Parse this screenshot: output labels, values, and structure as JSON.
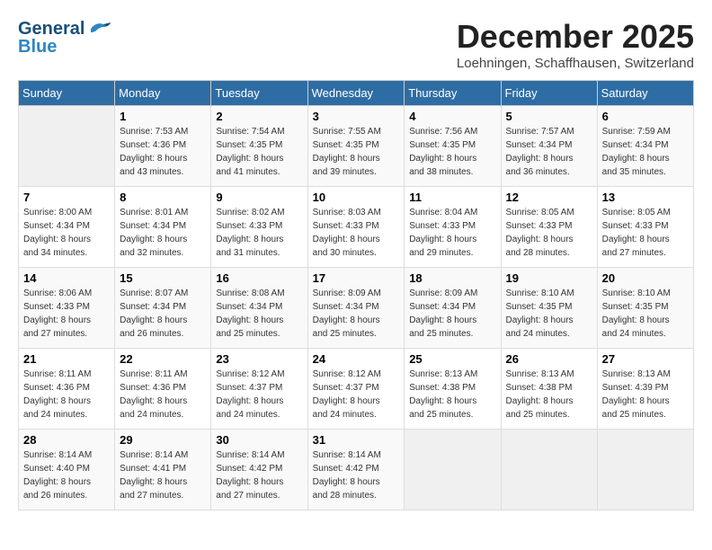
{
  "logo": {
    "line1": "General",
    "line2": "Blue"
  },
  "title": "December 2025",
  "location": "Loehningen, Schaffhausen, Switzerland",
  "weekdays": [
    "Sunday",
    "Monday",
    "Tuesday",
    "Wednesday",
    "Thursday",
    "Friday",
    "Saturday"
  ],
  "weeks": [
    [
      {
        "day": "",
        "info": ""
      },
      {
        "day": "1",
        "info": "Sunrise: 7:53 AM\nSunset: 4:36 PM\nDaylight: 8 hours\nand 43 minutes."
      },
      {
        "day": "2",
        "info": "Sunrise: 7:54 AM\nSunset: 4:35 PM\nDaylight: 8 hours\nand 41 minutes."
      },
      {
        "day": "3",
        "info": "Sunrise: 7:55 AM\nSunset: 4:35 PM\nDaylight: 8 hours\nand 39 minutes."
      },
      {
        "day": "4",
        "info": "Sunrise: 7:56 AM\nSunset: 4:35 PM\nDaylight: 8 hours\nand 38 minutes."
      },
      {
        "day": "5",
        "info": "Sunrise: 7:57 AM\nSunset: 4:34 PM\nDaylight: 8 hours\nand 36 minutes."
      },
      {
        "day": "6",
        "info": "Sunrise: 7:59 AM\nSunset: 4:34 PM\nDaylight: 8 hours\nand 35 minutes."
      }
    ],
    [
      {
        "day": "7",
        "info": "Sunrise: 8:00 AM\nSunset: 4:34 PM\nDaylight: 8 hours\nand 34 minutes."
      },
      {
        "day": "8",
        "info": "Sunrise: 8:01 AM\nSunset: 4:34 PM\nDaylight: 8 hours\nand 32 minutes."
      },
      {
        "day": "9",
        "info": "Sunrise: 8:02 AM\nSunset: 4:33 PM\nDaylight: 8 hours\nand 31 minutes."
      },
      {
        "day": "10",
        "info": "Sunrise: 8:03 AM\nSunset: 4:33 PM\nDaylight: 8 hours\nand 30 minutes."
      },
      {
        "day": "11",
        "info": "Sunrise: 8:04 AM\nSunset: 4:33 PM\nDaylight: 8 hours\nand 29 minutes."
      },
      {
        "day": "12",
        "info": "Sunrise: 8:05 AM\nSunset: 4:33 PM\nDaylight: 8 hours\nand 28 minutes."
      },
      {
        "day": "13",
        "info": "Sunrise: 8:05 AM\nSunset: 4:33 PM\nDaylight: 8 hours\nand 27 minutes."
      }
    ],
    [
      {
        "day": "14",
        "info": "Sunrise: 8:06 AM\nSunset: 4:33 PM\nDaylight: 8 hours\nand 27 minutes."
      },
      {
        "day": "15",
        "info": "Sunrise: 8:07 AM\nSunset: 4:34 PM\nDaylight: 8 hours\nand 26 minutes."
      },
      {
        "day": "16",
        "info": "Sunrise: 8:08 AM\nSunset: 4:34 PM\nDaylight: 8 hours\nand 25 minutes."
      },
      {
        "day": "17",
        "info": "Sunrise: 8:09 AM\nSunset: 4:34 PM\nDaylight: 8 hours\nand 25 minutes."
      },
      {
        "day": "18",
        "info": "Sunrise: 8:09 AM\nSunset: 4:34 PM\nDaylight: 8 hours\nand 25 minutes."
      },
      {
        "day": "19",
        "info": "Sunrise: 8:10 AM\nSunset: 4:35 PM\nDaylight: 8 hours\nand 24 minutes."
      },
      {
        "day": "20",
        "info": "Sunrise: 8:10 AM\nSunset: 4:35 PM\nDaylight: 8 hours\nand 24 minutes."
      }
    ],
    [
      {
        "day": "21",
        "info": "Sunrise: 8:11 AM\nSunset: 4:36 PM\nDaylight: 8 hours\nand 24 minutes."
      },
      {
        "day": "22",
        "info": "Sunrise: 8:11 AM\nSunset: 4:36 PM\nDaylight: 8 hours\nand 24 minutes."
      },
      {
        "day": "23",
        "info": "Sunrise: 8:12 AM\nSunset: 4:37 PM\nDaylight: 8 hours\nand 24 minutes."
      },
      {
        "day": "24",
        "info": "Sunrise: 8:12 AM\nSunset: 4:37 PM\nDaylight: 8 hours\nand 24 minutes."
      },
      {
        "day": "25",
        "info": "Sunrise: 8:13 AM\nSunset: 4:38 PM\nDaylight: 8 hours\nand 25 minutes."
      },
      {
        "day": "26",
        "info": "Sunrise: 8:13 AM\nSunset: 4:38 PM\nDaylight: 8 hours\nand 25 minutes."
      },
      {
        "day": "27",
        "info": "Sunrise: 8:13 AM\nSunset: 4:39 PM\nDaylight: 8 hours\nand 25 minutes."
      }
    ],
    [
      {
        "day": "28",
        "info": "Sunrise: 8:14 AM\nSunset: 4:40 PM\nDaylight: 8 hours\nand 26 minutes."
      },
      {
        "day": "29",
        "info": "Sunrise: 8:14 AM\nSunset: 4:41 PM\nDaylight: 8 hours\nand 27 minutes."
      },
      {
        "day": "30",
        "info": "Sunrise: 8:14 AM\nSunset: 4:42 PM\nDaylight: 8 hours\nand 27 minutes."
      },
      {
        "day": "31",
        "info": "Sunrise: 8:14 AM\nSunset: 4:42 PM\nDaylight: 8 hours\nand 28 minutes."
      },
      {
        "day": "",
        "info": ""
      },
      {
        "day": "",
        "info": ""
      },
      {
        "day": "",
        "info": ""
      }
    ]
  ]
}
